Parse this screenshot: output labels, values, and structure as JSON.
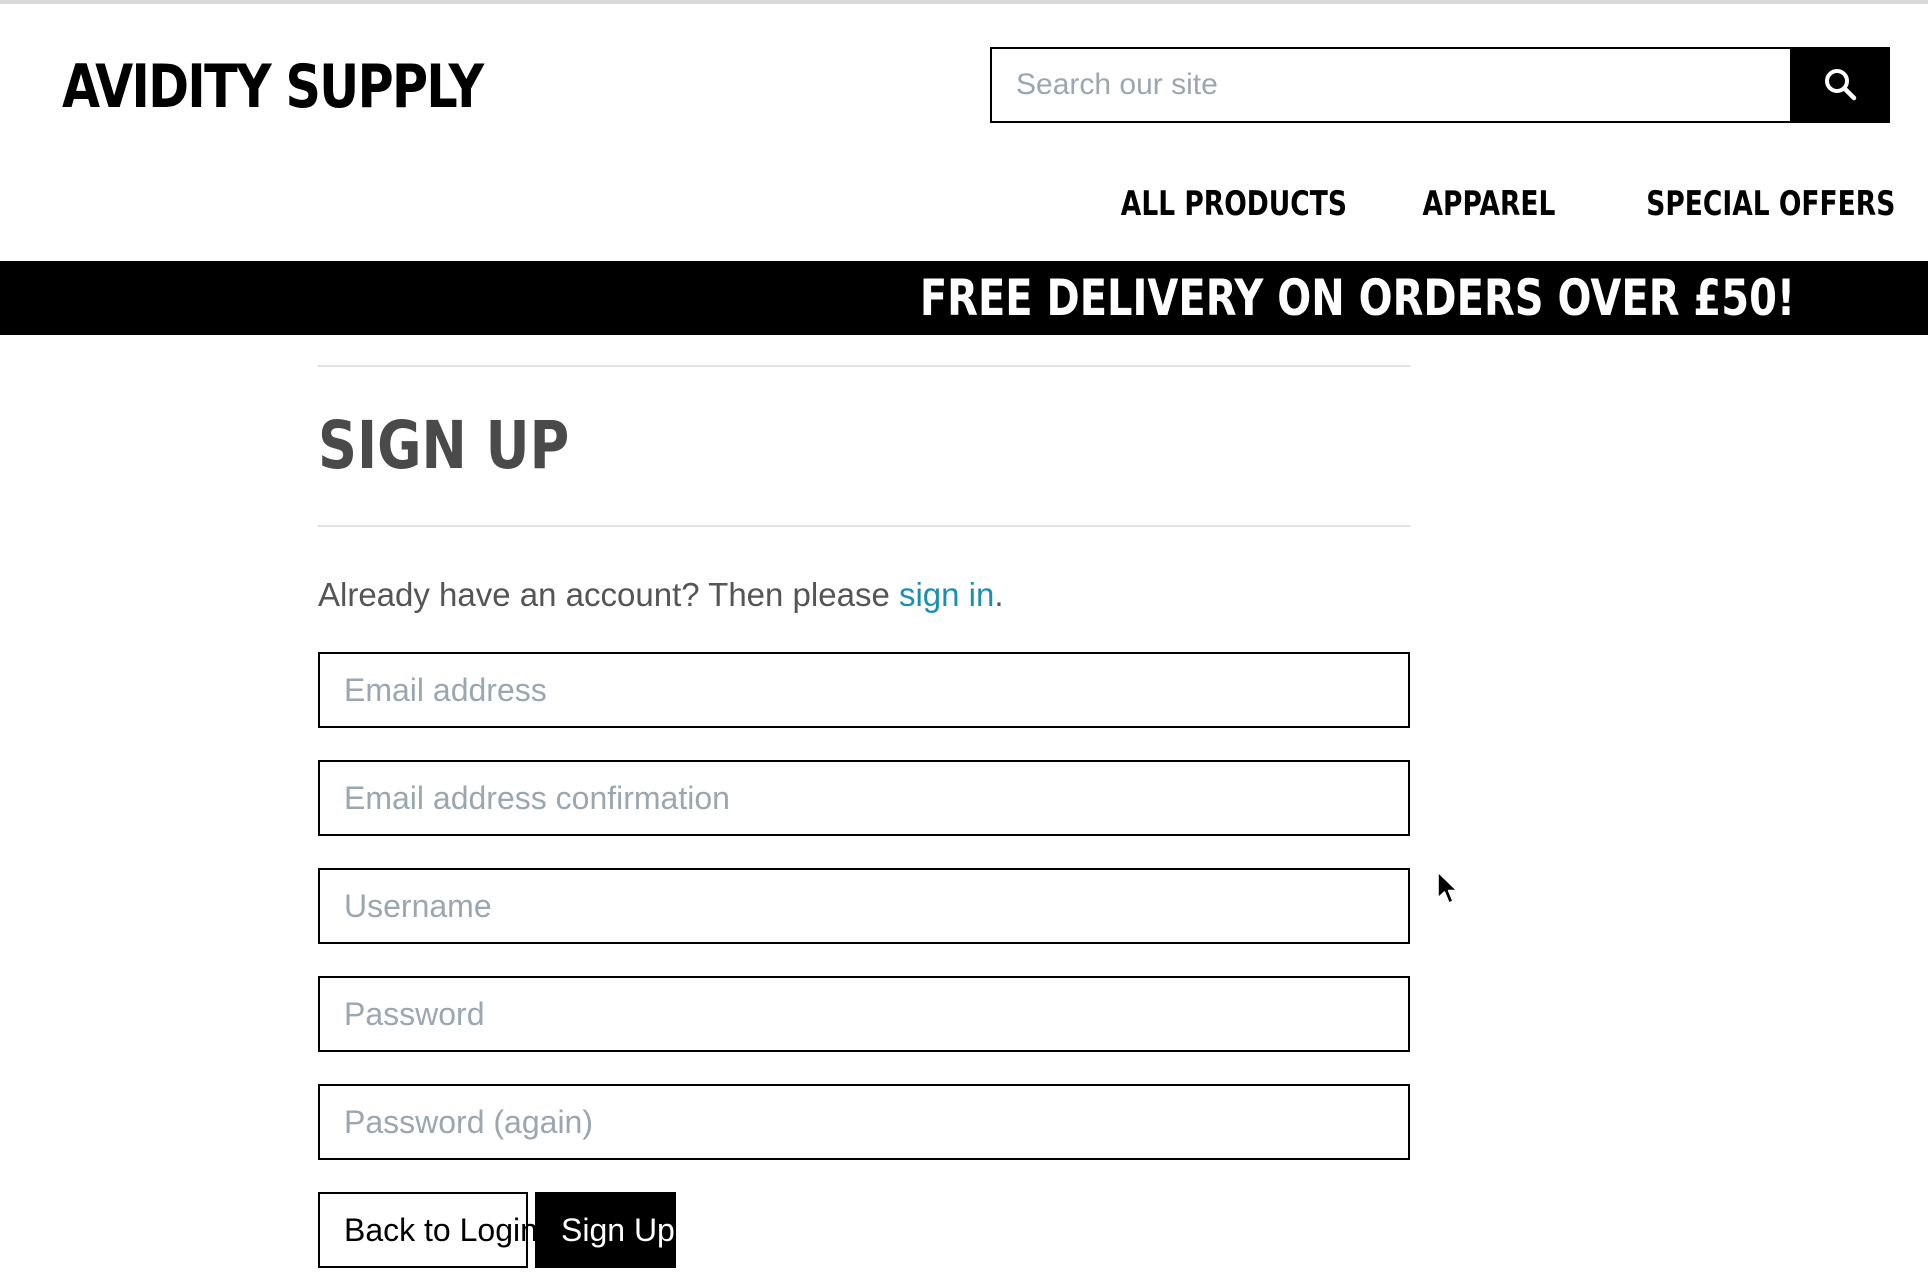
{
  "header": {
    "logo": "AVIDITY SUPPLY",
    "search": {
      "placeholder": "Search our site",
      "value": "",
      "icon": "search-icon"
    },
    "nav": [
      {
        "label": "ALL PRODUCTS"
      },
      {
        "label": "APPAREL"
      },
      {
        "label": "SPECIAL OFFERS"
      }
    ]
  },
  "banner": {
    "text": "FREE DELIVERY ON ORDERS OVER £50!"
  },
  "signup": {
    "title": "SIGN UP",
    "intro_prefix": "Already have an account? Then please ",
    "intro_link": "sign in",
    "intro_suffix": ".",
    "fields": {
      "email": {
        "placeholder": "Email address",
        "value": ""
      },
      "email_confirm": {
        "placeholder": "Email address confirmation",
        "value": ""
      },
      "username": {
        "placeholder": "Username",
        "value": ""
      },
      "password": {
        "placeholder": "Password",
        "value": ""
      },
      "password_again": {
        "placeholder": "Password (again)",
        "value": ""
      }
    },
    "buttons": {
      "back": "Back to Login",
      "submit": "Sign Up"
    }
  },
  "colors": {
    "link": "#1a8fb0",
    "banner_bg": "#000000",
    "placeholder": "#9aa7b1",
    "title": "#4a4a4a"
  }
}
